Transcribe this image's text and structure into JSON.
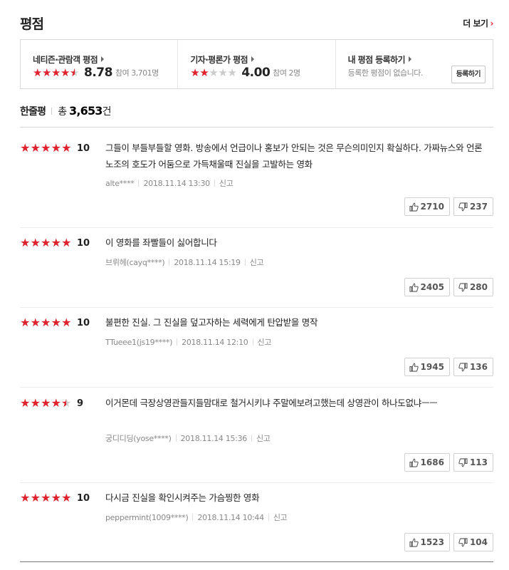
{
  "header": {
    "title": "평점",
    "more": "더 보기",
    "more_arrow": "›"
  },
  "summary": {
    "netizen": {
      "label": "네티즌·관람객 평점",
      "score": "8.78",
      "count": "참여 3,701명",
      "stars_value": 4.5
    },
    "critic": {
      "label": "기자·평론가 평점",
      "score": "4.00",
      "count": "참여 2명",
      "stars_value": 2
    },
    "mine": {
      "label": "내 평점 등록하기",
      "empty_text": "등록한 평점이 없습니다.",
      "button": "등록하기"
    }
  },
  "count": {
    "label": "한줄평",
    "prefix": "총",
    "number": "3,653",
    "suffix": "건"
  },
  "colors": {
    "accent": "#e0212e",
    "star_off": "#cccccc"
  },
  "icons": {
    "like": "thumb-up-icon",
    "dislike": "thumb-down-icon",
    "star": "star-icon"
  },
  "reviews": [
    {
      "score": "10",
      "stars_value": 5,
      "text": "그들이 부들부들할 영화. 방송에서 언급이나 홍보가 안되는 것은 무슨의미인지 확실하다. 가짜뉴스와 언론노조의 호도가 어둠으로 가득채울때 진실을 고발하는 영화",
      "user": "alte****",
      "date": "2018.11.14 13:30",
      "report": "신고",
      "likes": "2710",
      "dislikes": "237"
    },
    {
      "score": "10",
      "stars_value": 5,
      "text": "이 영화를 좌빨들이 싫어합니다",
      "user": "브뤼헤(cayq****)",
      "date": "2018.11.14 15:19",
      "report": "신고",
      "likes": "2405",
      "dislikes": "280"
    },
    {
      "score": "10",
      "stars_value": 5,
      "text": "불편한 진실. 그 진실을 덮고자하는 세력에게 탄압받을 명작",
      "user": "TTueee1(js19****)",
      "date": "2018.11.14 12:10",
      "report": "신고",
      "likes": "1945",
      "dislikes": "136"
    },
    {
      "score": "9",
      "stars_value": 4.5,
      "text": "이거몬데 극장상영관들지들맘대로 철거시키냐 주말에보려고했는데 상영관이 하나도없냐ㅡㅡ",
      "user": "궁디디딩(yose****)",
      "date": "2018.11.14 15:36",
      "report": "신고",
      "likes": "1686",
      "dislikes": "113"
    },
    {
      "score": "10",
      "stars_value": 5,
      "text": "다시금 진실을 확인시켜주는 가슴찡한 영화",
      "user": "peppermint(1009****)",
      "date": "2018.11.14 10:44",
      "report": "신고",
      "likes": "1523",
      "dislikes": "104"
    }
  ]
}
